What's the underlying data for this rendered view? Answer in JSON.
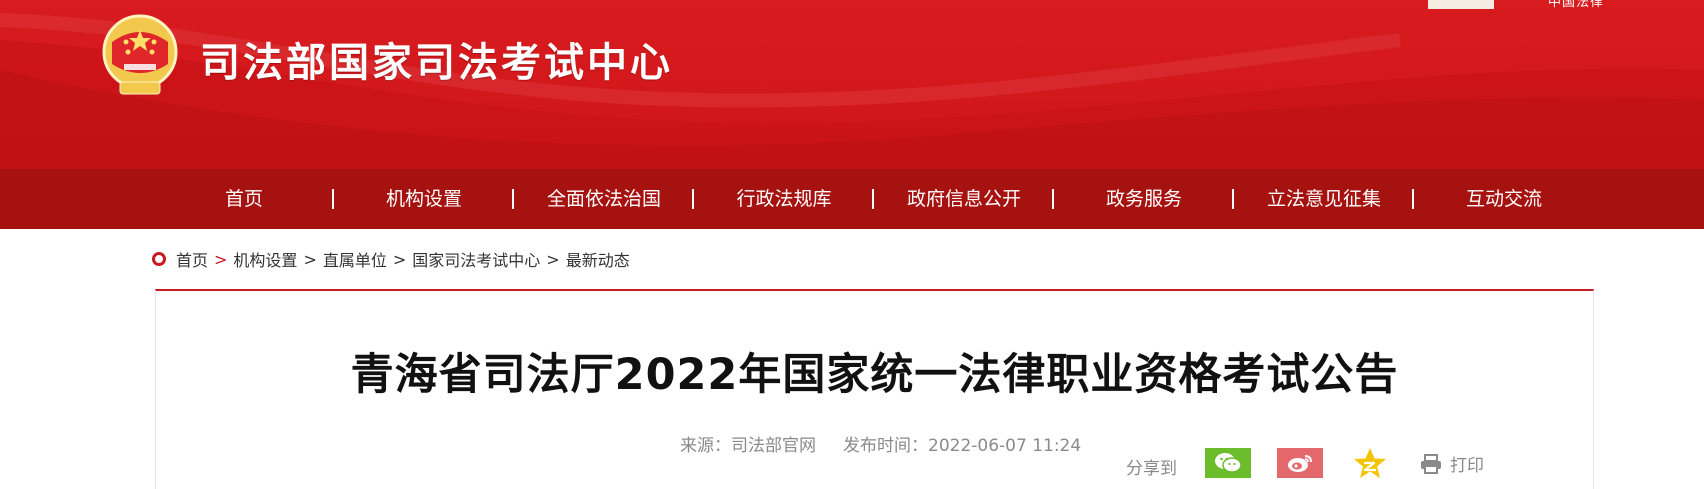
{
  "header": {
    "site_title": "司法部国家司法考试中心",
    "top_right_text": "中国法律",
    "emblem_icon": "justice-emblem-icon"
  },
  "nav": {
    "items": [
      {
        "label": "首页"
      },
      {
        "label": "机构设置"
      },
      {
        "label": "全面依法治国"
      },
      {
        "label": "行政法规库"
      },
      {
        "label": "政府信息公开"
      },
      {
        "label": "政务服务"
      },
      {
        "label": "立法意见征集"
      },
      {
        "label": "互动交流"
      }
    ]
  },
  "breadcrumb": {
    "items": [
      "首页",
      "机构设置",
      "直属单位",
      "国家司法考试中心",
      "最新动态"
    ],
    "separator": ">"
  },
  "article": {
    "title": "青海省司法厅2022年国家统一法律职业资格考试公告",
    "source": "来源：司法部官网",
    "publish_time": "发布时间：2022-06-07 11:24"
  },
  "share": {
    "label": "分享到",
    "buttons": [
      "wechat-icon",
      "weibo-icon",
      "qzone-icon"
    ],
    "print_label": "打印"
  },
  "colors": {
    "banner_red": "#d81b1f",
    "nav_red": "#a6120f",
    "accent_red": "#c91a1f",
    "wechat_green": "#6bbd2b",
    "weibo_pink": "#e3676b",
    "qzone_yellow": "#f5c400"
  }
}
